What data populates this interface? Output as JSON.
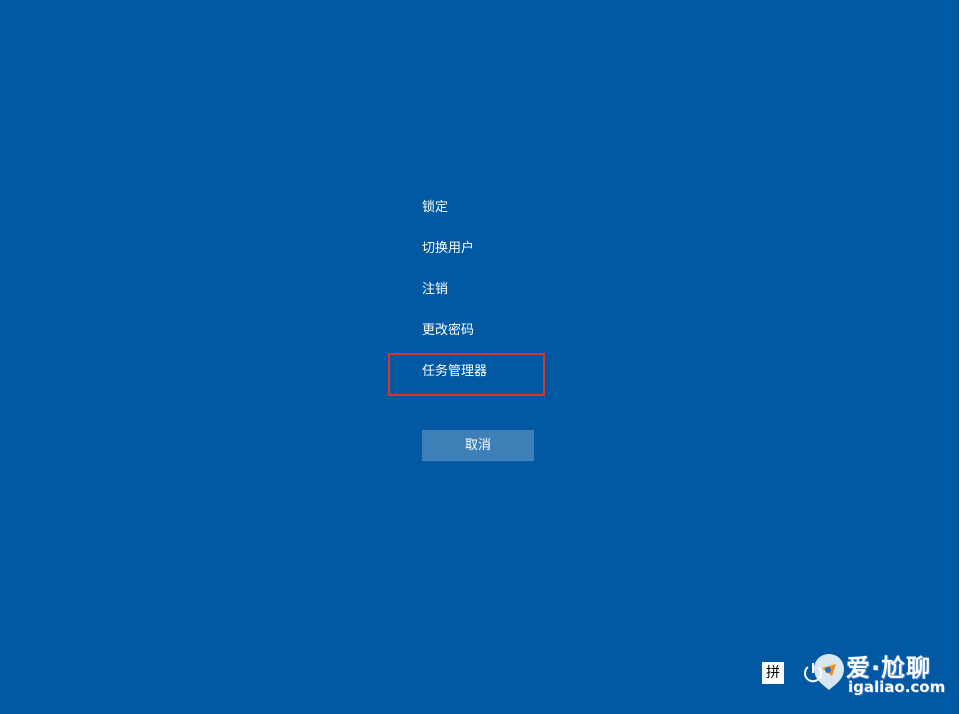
{
  "screen": {
    "background_color": "#0158a3"
  },
  "menu": {
    "items": [
      {
        "label": "锁定"
      },
      {
        "label": "切换用户"
      },
      {
        "label": "注销"
      },
      {
        "label": "更改密码"
      },
      {
        "label": "任务管理器"
      }
    ]
  },
  "highlight": {
    "target": "任务管理器",
    "color": "#d9352b"
  },
  "cancel": {
    "label": "取消"
  },
  "tray": {
    "ime_label": "拼",
    "power_icon": "power-icon"
  },
  "watermark": {
    "brand": "爱·尬聊",
    "url": "igaliao.com"
  }
}
